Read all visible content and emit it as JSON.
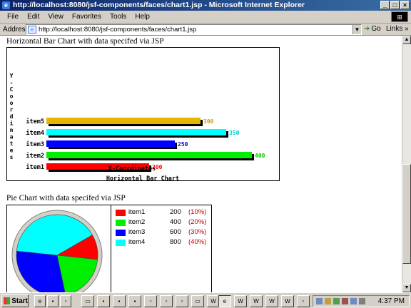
{
  "window": {
    "title": "http://localhost:8080/jsf-components/faces/chart1.jsp - Microsoft Internet Explorer"
  },
  "menu": [
    "File",
    "Edit",
    "View",
    "Favorites",
    "Tools",
    "Help"
  ],
  "address": {
    "label": "Address",
    "url": "http://localhost:8080/jsf-components/faces/chart1.jsp",
    "go": "Go",
    "links": "Links"
  },
  "bar_section": {
    "heading": "Horizontal Bar Chart with data specifed via JSP"
  },
  "pie_section": {
    "heading": "Pie Chart with data specifed via JSP"
  },
  "chart_data": [
    {
      "type": "bar",
      "orientation": "horizontal",
      "title": "Horizontal Bar Chart",
      "xlabel": "X-Coordinates",
      "ylabel": "Y-Coordinates",
      "categories": [
        "item1",
        "item2",
        "item3",
        "item4",
        "item5"
      ],
      "values": [
        200,
        400,
        250,
        350,
        300
      ],
      "colors": [
        "#ff0000",
        "#00ee00",
        "#0000ff",
        "#00ffff",
        "#e8b400"
      ],
      "value_label_colors": [
        "#ff0000",
        "#00cc00",
        "#0000cc",
        "#00cccc",
        "#d4a000"
      ]
    },
    {
      "type": "pie",
      "categories": [
        "item1",
        "item2",
        "item3",
        "item4"
      ],
      "values": [
        200,
        400,
        600,
        800
      ],
      "percent_labels": [
        "(10%)",
        "(20%)",
        "(30%)",
        "(40%)"
      ],
      "colors": [
        "#ff0000",
        "#00ee00",
        "#0000ff",
        "#00ffff"
      ]
    }
  ],
  "taskbar": {
    "start": "Start",
    "clock": "4:37 PM"
  }
}
